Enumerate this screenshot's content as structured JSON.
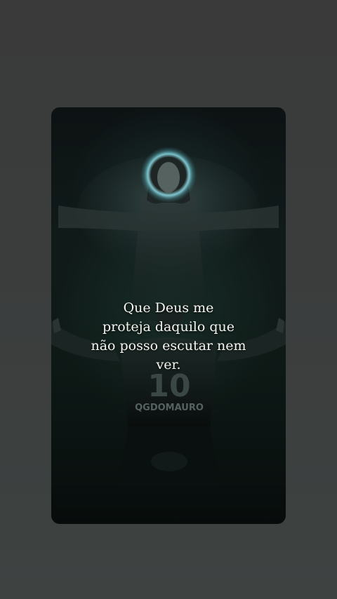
{
  "story": {
    "caption_lines": [
      "Que Deus me",
      "proteja daquilo que",
      "não posso escutar nem",
      "ver."
    ],
    "jersey_number": "10",
    "jersey_name": "QGDOMAURO",
    "accent_glow": "#7fd6e0"
  }
}
